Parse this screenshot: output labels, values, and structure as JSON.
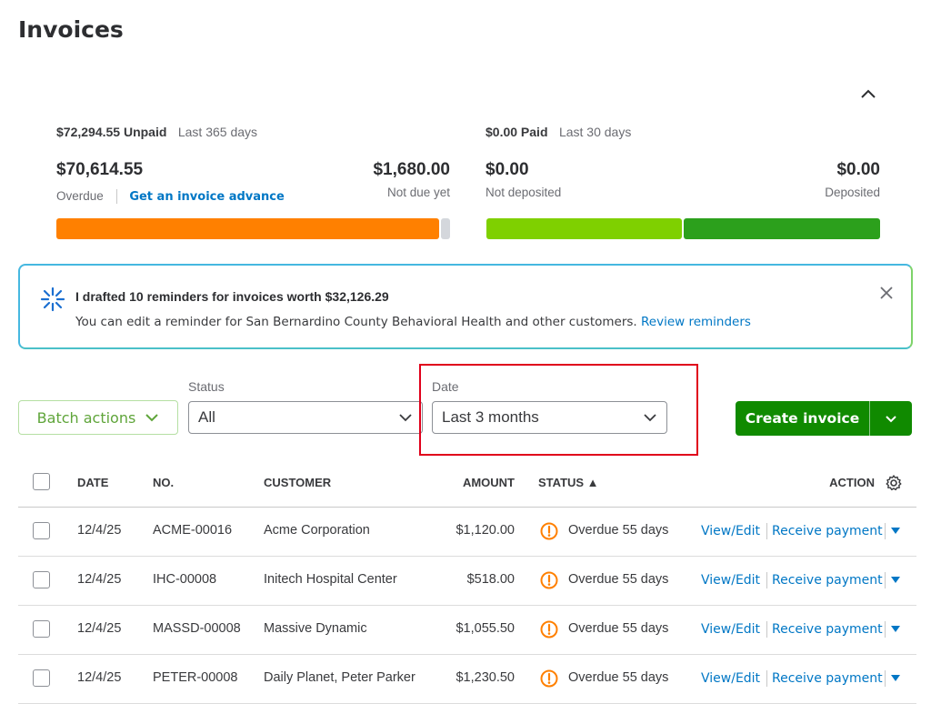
{
  "page": {
    "title": "Invoices"
  },
  "summary": {
    "unpaid": {
      "amount_label": "$72,294.55 Unpaid",
      "period": "Last 365 days",
      "overdue_amount": "$70,614.55",
      "overdue_label": "Overdue",
      "advance_link": "Get an invoice advance",
      "not_due_amount": "$1,680.00",
      "not_due_label": "Not due yet",
      "overdue_fraction": 0.977,
      "colors": {
        "overdue": "#ff8000",
        "not_due": "#d4d7dc"
      }
    },
    "paid": {
      "amount_label": "$0.00 Paid",
      "period": "Last 30 days",
      "not_deposited_amount": "$0.00",
      "not_deposited_label": "Not deposited",
      "deposited_amount": "$0.00",
      "deposited_label": "Deposited",
      "colors": {
        "not_deposited": "#7fd000",
        "deposited": "#2ca01c"
      }
    }
  },
  "banner": {
    "title": "I drafted 10 reminders for invoices worth $32,126.29",
    "text": "You can edit a reminder for San Bernardino County Behavioral Health and other customers.",
    "link": "Review reminders",
    "icon": "sparkle-icon"
  },
  "filters": {
    "batch_label": "Batch actions",
    "status_label": "Status",
    "status_value": "All",
    "date_label": "Date",
    "date_value": "Last 3 months",
    "create_label": "Create invoice"
  },
  "table": {
    "headers": {
      "date": "DATE",
      "no": "NO.",
      "customer": "CUSTOMER",
      "amount": "AMOUNT",
      "status": "STATUS ▲",
      "action": "ACTION"
    },
    "rows": [
      {
        "date": "12/4/25",
        "no": "ACME-00016",
        "customer": "Acme Corporation",
        "amount": "$1,120.00",
        "status": "Overdue 55 days",
        "view": "View/Edit",
        "receive": "Receive payment"
      },
      {
        "date": "12/4/25",
        "no": "IHC-00008",
        "customer": "Initech Hospital Center",
        "amount": "$518.00",
        "status": "Overdue 55 days",
        "view": "View/Edit",
        "receive": "Receive payment"
      },
      {
        "date": "12/4/25",
        "no": "MASSD-00008",
        "customer": "Massive Dynamic",
        "amount": "$1,055.50",
        "status": "Overdue 55 days",
        "view": "View/Edit",
        "receive": "Receive payment"
      },
      {
        "date": "12/4/25",
        "no": "PETER-00008",
        "customer": "Daily Planet, Peter Parker",
        "amount": "$1,230.50",
        "status": "Overdue 55 days",
        "view": "View/Edit",
        "receive": "Receive payment"
      }
    ]
  }
}
